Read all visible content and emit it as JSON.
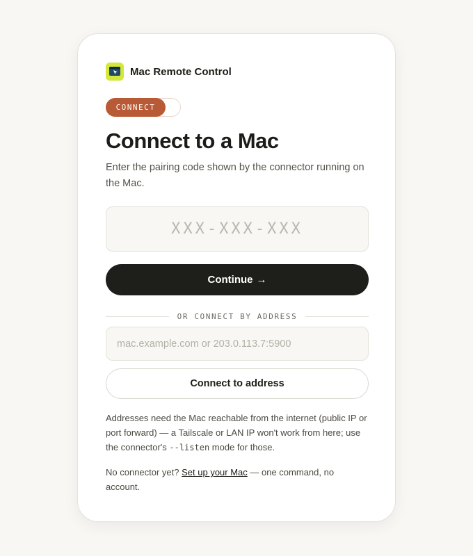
{
  "brand": {
    "name": "Mac Remote Control",
    "logo_icon": "monitor-cursor-icon",
    "logo_color": "#d3e83a"
  },
  "step_badge": {
    "label": "CONNECT",
    "color": "#b85a36",
    "progress": 0.8
  },
  "heading": {
    "title": "Connect to a Mac",
    "subtitle": "Enter the pairing code shown by the connector running on the Mac."
  },
  "pairing": {
    "placeholder": "XXX-XXX-XXX",
    "value": "",
    "continue_label": "Continue",
    "continue_arrow": "→"
  },
  "address": {
    "divider_label": "OR CONNECT BY ADDRESS",
    "placeholder": "mac.example.com or 203.0.113.7:5900",
    "value": "",
    "connect_label": "Connect to address"
  },
  "note": {
    "part1": "Addresses need the Mac reachable from the internet (public IP or port forward) — a Tailscale or LAN IP won't work from here; use the connector's ",
    "code": "--listen",
    "part2": " mode for those."
  },
  "footer": {
    "prefix": "No connector yet? ",
    "link": "Set up your Mac",
    "suffix": " — one command, no account."
  }
}
